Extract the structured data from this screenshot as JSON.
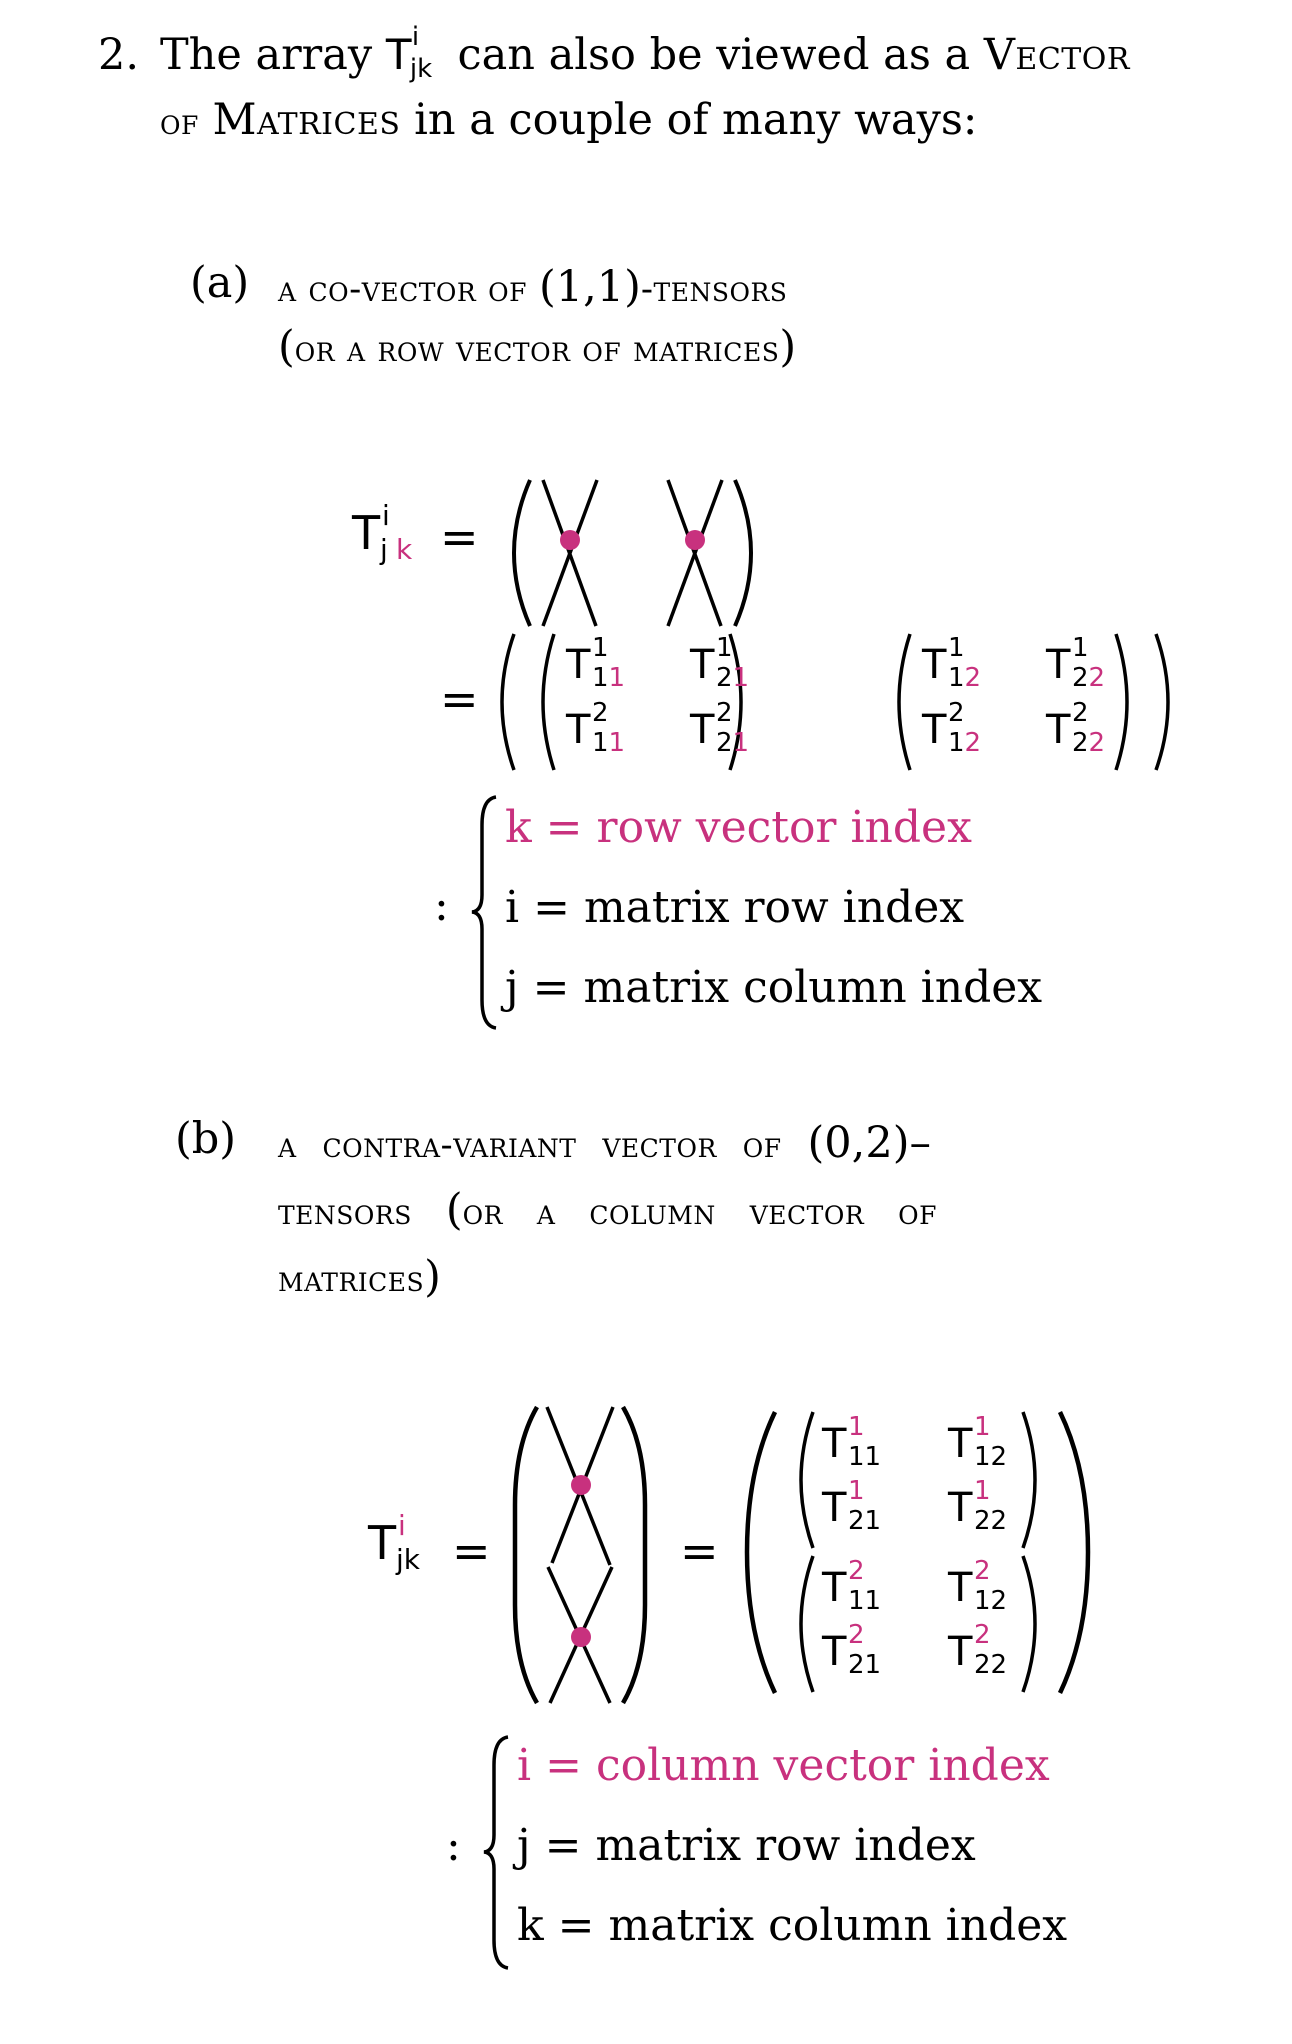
{
  "item": {
    "number": "2.",
    "line1_pre": "The array ",
    "tensor": {
      "base": "T",
      "sup": "i",
      "sub": "jk"
    },
    "line1_post": " can also be viewed as a ",
    "line1_sc": "Vector",
    "line2_sc1": "of",
    "line2_sc2": "Matrices",
    "line2_post": " in a couple of many ways:"
  },
  "section_a": {
    "label": "(a)",
    "heading_line1_a": "a co-vector of ",
    "heading_line1_tuple": "(1,1)",
    "heading_line1_b": "-tensors",
    "heading_line2_open": "(",
    "heading_line2_text": "or a row vector of matrices",
    "heading_line2_close": ")",
    "lhs": {
      "base": "T",
      "sup": "i",
      "sub_j": "j",
      "sub_k": "k"
    },
    "equals": "=",
    "matrices": [
      {
        "cells": [
          {
            "sup": "1",
            "sub_j": "1",
            "sub_k": "1"
          },
          {
            "sup": "1",
            "sub_j": "2",
            "sub_k": "1"
          },
          {
            "sup": "2",
            "sub_j": "1",
            "sub_k": "1"
          },
          {
            "sup": "2",
            "sub_j": "2",
            "sub_k": "1"
          }
        ]
      },
      {
        "cells": [
          {
            "sup": "1",
            "sub_j": "1",
            "sub_k": "2"
          },
          {
            "sup": "1",
            "sub_j": "2",
            "sub_k": "2"
          },
          {
            "sup": "2",
            "sub_j": "1",
            "sub_k": "2"
          },
          {
            "sup": "2",
            "sub_j": "2",
            "sub_k": "2"
          }
        ]
      }
    ],
    "colon": ":",
    "legend": [
      {
        "var": "k",
        "eq": "=",
        "text": " row vector index",
        "highlight": true
      },
      {
        "var": "i",
        "eq": "=",
        "text": "matrix row index",
        "highlight": false
      },
      {
        "var": "j",
        "eq": "=",
        "text": "matrix column index",
        "highlight": false
      }
    ]
  },
  "section_b": {
    "label": "(b)",
    "heading_line1_a": "a contra-variant vector of ",
    "heading_line1_tuple": "(0,2)",
    "heading_line1_b": "–",
    "heading_line2_a": "tensors ",
    "heading_line2_open": "(",
    "heading_line2_text": "or a column vector of",
    "heading_line3_text": "matrices",
    "heading_line3_close": ")",
    "lhs": {
      "base": "T",
      "sup": "i",
      "sub": "jk"
    },
    "equals": "=",
    "matrices": [
      {
        "cells": [
          {
            "sup": "1",
            "sub": "11"
          },
          {
            "sup": "1",
            "sub": "12"
          },
          {
            "sup": "1",
            "sub": "21"
          },
          {
            "sup": "1",
            "sub": "22"
          }
        ]
      },
      {
        "cells": [
          {
            "sup": "2",
            "sub": "11"
          },
          {
            "sup": "2",
            "sub": "12"
          },
          {
            "sup": "2",
            "sub": "21"
          },
          {
            "sup": "2",
            "sub": "22"
          }
        ]
      }
    ],
    "colon": ":",
    "legend": [
      {
        "var": "i",
        "eq": "=",
        "text": " column vector index",
        "highlight": true
      },
      {
        "var": "j",
        "eq": "=",
        "text": "matrix row index",
        "highlight": false
      },
      {
        "var": "k",
        "eq": "=",
        "text": "matrix column index",
        "highlight": false
      }
    ]
  },
  "colors": {
    "highlight": "#c8317e",
    "text": "#000000",
    "background": "#ffffff"
  }
}
